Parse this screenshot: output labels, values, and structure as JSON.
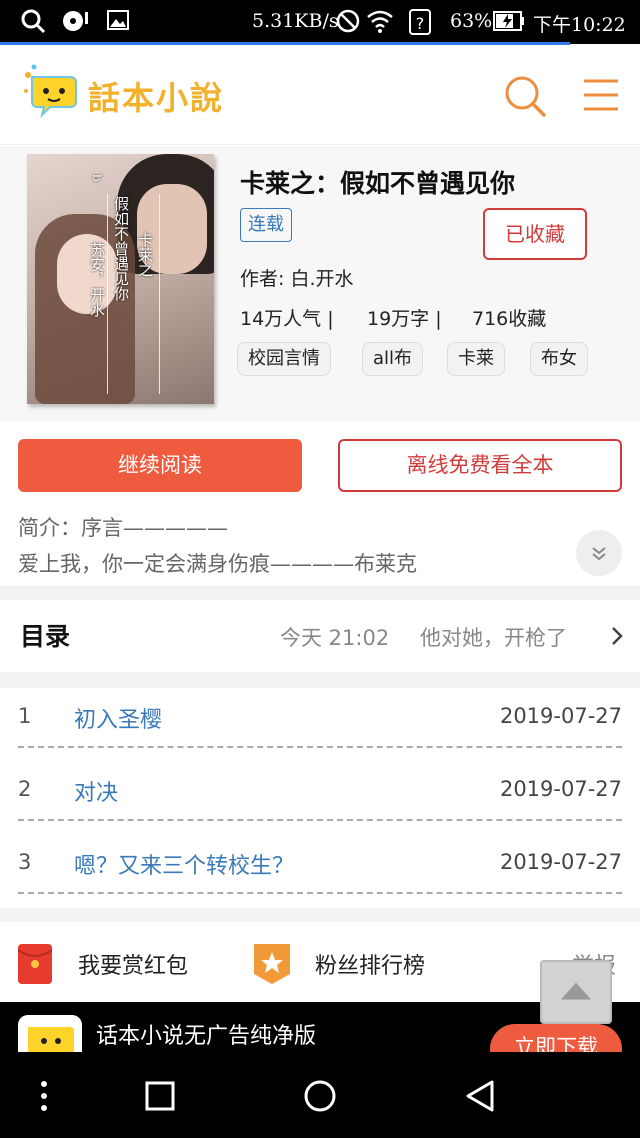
{
  "status_bar": {
    "net_speed": "5.31KB/s",
    "battery": "63%",
    "time": "下午10:22"
  },
  "header": {
    "app_name": "話本小說"
  },
  "book": {
    "title": "卡莱之：假如不曾遇见你",
    "status": "连载",
    "collect_label": "已收藏",
    "author": "作者: 白.开水",
    "popularity": "14万人气 |",
    "word_count": "19万字 |",
    "collections": "716收藏",
    "tags": [
      "校园言情",
      "all布",
      "卡莱",
      "布女"
    ],
    "cover_text": {
      "col1": "苏安，开水",
      "col2": "假如不曾遇见你",
      "col3": "卡莱之",
      "small": "b"
    }
  },
  "actions": {
    "continue_read": "继续阅读",
    "offline_free": "离线免费看全本"
  },
  "intro": {
    "line1": "简介：序言—————",
    "line2": "爱上我，你一定会满身伤痕————布莱克"
  },
  "catalog": {
    "title": "目录",
    "latest_time": "今天 21:02",
    "latest_title": "他对她，开枪了",
    "chapters": [
      {
        "num": "1",
        "name": "初入圣樱",
        "date": "2019-07-27"
      },
      {
        "num": "2",
        "name": "对决",
        "date": "2019-07-27"
      },
      {
        "num": "3",
        "name": "嗯？又来三个转校生？",
        "date": "2019-07-27"
      }
    ]
  },
  "links": {
    "reward": "我要赏红包",
    "fans": "粉丝排行榜",
    "report": "举报"
  },
  "ad": {
    "text": "话本小说无广告纯净版",
    "button": "立即下载"
  },
  "colors": {
    "accent": "#ef5b3e",
    "collect_red": "#d33b3b",
    "link_blue": "#3a7ab8",
    "logo_yellow": "#f1b12a"
  }
}
